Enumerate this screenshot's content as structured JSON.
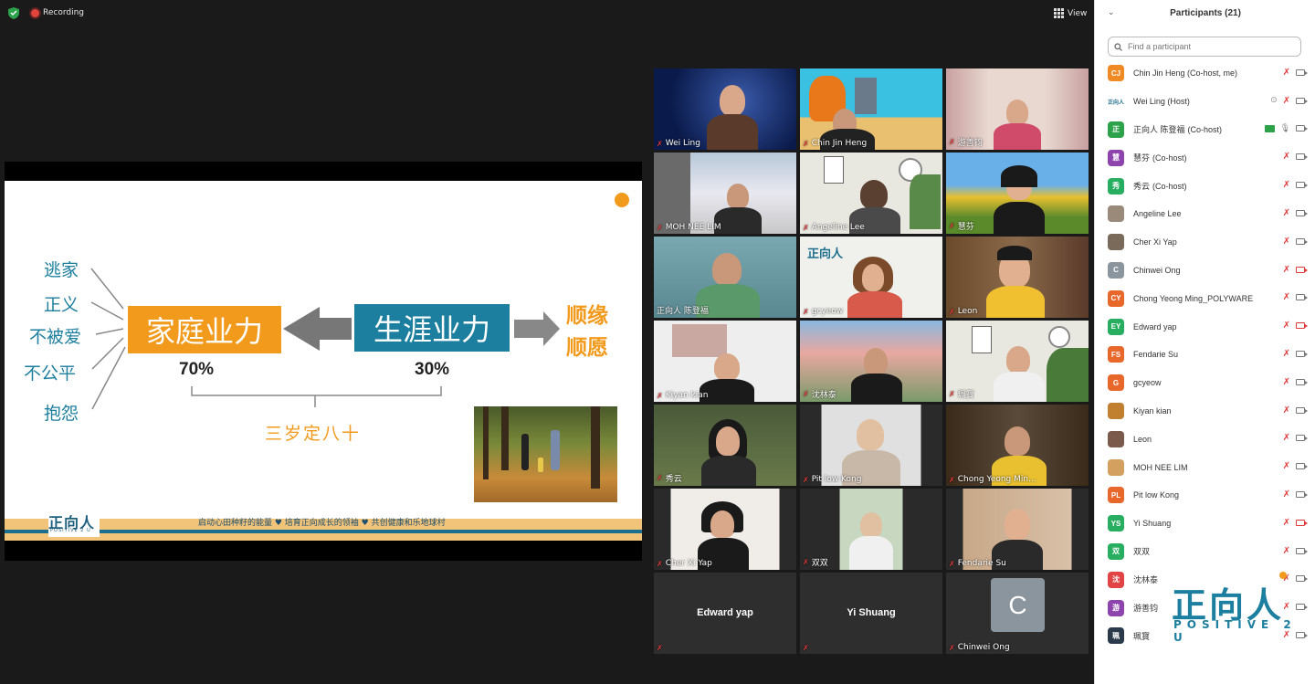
{
  "topbar": {
    "recording": "Recording",
    "view": "View"
  },
  "slide": {
    "left_words": [
      "逃家",
      "正义",
      "不被爱",
      "不公平",
      "抱怨"
    ],
    "box_left": "家庭业力",
    "box_right": "生涯业力",
    "right_words": [
      "顺缘",
      "顺愿"
    ],
    "pct_left": "70%",
    "pct_right": "30%",
    "caption": "三岁定八十",
    "footer": "启动心田种籽的能量 ♥ 培育正向成长的领袖 ♥ 共创健康和乐地球村",
    "logo_cn": "正向人",
    "logo_en": "POSITIVE 2 U"
  },
  "gallery": [
    {
      "name": "Wei Ling"
    },
    {
      "name": "Chin Jin Heng"
    },
    {
      "name": "游善钧"
    },
    {
      "name": "MOH NEE LIM"
    },
    {
      "name": "Angeline Lee"
    },
    {
      "name": "慧芬"
    },
    {
      "name": "正向人 陈登福"
    },
    {
      "name": "gcyeow"
    },
    {
      "name": "Leon"
    },
    {
      "name": "Kiyan kian"
    },
    {
      "name": "沈林泰"
    },
    {
      "name": "珮寳"
    },
    {
      "name": "秀云"
    },
    {
      "name": "Pit low Kong"
    },
    {
      "name": "Chong Yeong Min..."
    },
    {
      "name": "Cher Xi Yap"
    },
    {
      "name": "双双"
    },
    {
      "name": "Fendarie Su"
    },
    {
      "name": "Edward yap"
    },
    {
      "name": "Yi Shuang"
    },
    {
      "name": "Chinwei Ong",
      "initial": "C"
    }
  ],
  "panel": {
    "title": "Participants (21)",
    "search_placeholder": "Find a participant",
    "participants": [
      {
        "initials": "CJ",
        "color": "#f08a24",
        "name": "Chin Jin Heng (Co-host, me)"
      },
      {
        "initials": "正向人",
        "color": "#ffffff",
        "name": "Wei Ling (Host)"
      },
      {
        "initials": "正",
        "color": "#2ca24b",
        "name": "正向人 陈登福",
        "role": "(Co-host)"
      },
      {
        "initials": "慧",
        "color": "#8e44ad",
        "name": "慧芬",
        "role": "(Co-host)"
      },
      {
        "initials": "秀",
        "color": "#27ae60",
        "name": "秀云",
        "role": "(Co-host)"
      },
      {
        "initials": "",
        "color": "#9a8a7a",
        "name": "Angeline Lee"
      },
      {
        "initials": "",
        "color": "#7a6a5a",
        "name": "Cher Xi Yap"
      },
      {
        "initials": "C",
        "color": "#8a959d",
        "name": "Chinwei Ong"
      },
      {
        "initials": "CY",
        "color": "#e8682c",
        "name": "Chong Yeong Ming_POLYWARE"
      },
      {
        "initials": "EY",
        "color": "#27ae60",
        "name": "Edward yap"
      },
      {
        "initials": "FS",
        "color": "#e8682c",
        "name": "Fendarie Su"
      },
      {
        "initials": "G",
        "color": "#e8682c",
        "name": "gcyeow"
      },
      {
        "initials": "",
        "color": "#c08030",
        "name": "Kiyan kian"
      },
      {
        "initials": "",
        "color": "#7a5a4a",
        "name": "Leon"
      },
      {
        "initials": "",
        "color": "#d4a060",
        "name": "MOH NEE LIM"
      },
      {
        "initials": "PL",
        "color": "#e8682c",
        "name": "Pit low Kong"
      },
      {
        "initials": "YS",
        "color": "#27ae60",
        "name": "Yi Shuang"
      },
      {
        "initials": "双",
        "color": "#27ae60",
        "name": "双双"
      },
      {
        "initials": "沈",
        "color": "#e04444",
        "name": "沈林泰"
      },
      {
        "initials": "游",
        "color": "#8e44ad",
        "name": "游善钧"
      },
      {
        "initials": "珮",
        "color": "#2a3a4a",
        "name": "珮寳"
      }
    ],
    "watermark_cn": "正向人",
    "watermark_en": "POSITIVE 2 U"
  }
}
